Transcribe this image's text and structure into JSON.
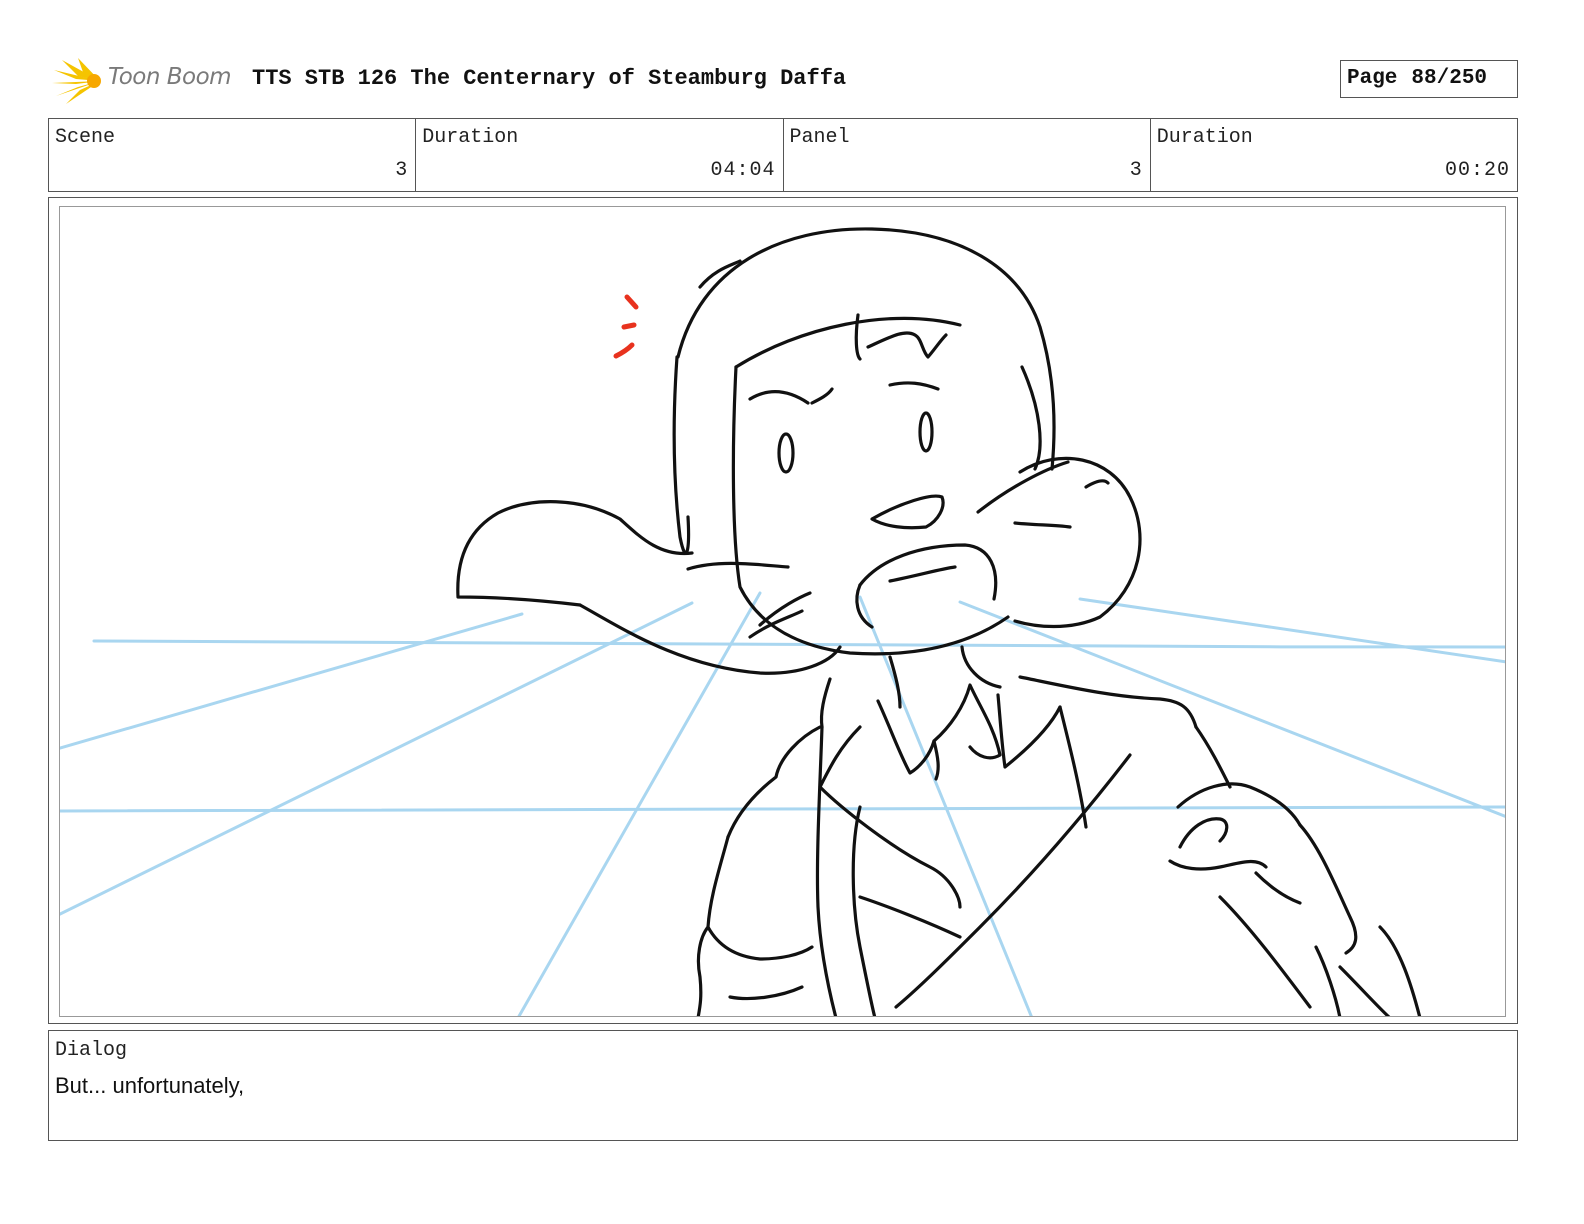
{
  "header": {
    "brand": "Toon Boom",
    "project_title": "TTS STB 126 The Centernary of Steamburg Daffa",
    "page_label": "Page",
    "page_value": "88/250"
  },
  "info": {
    "scene_label": "Scene",
    "scene_value": "3",
    "scene_duration_label": "Duration",
    "scene_duration_value": "04:04",
    "panel_label": "Panel",
    "panel_value": "3",
    "panel_duration_label": "Duration",
    "panel_duration_value": "00:20"
  },
  "dialog": {
    "label": "Dialog",
    "text": "But... unfortunately,"
  },
  "colors": {
    "ink": "#111111",
    "guide_blue": "#a9d6f0",
    "accent_red": "#e8321e",
    "logo_yellow": "#f5c400",
    "border": "#555555"
  }
}
